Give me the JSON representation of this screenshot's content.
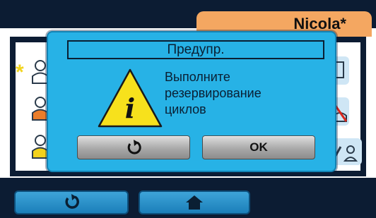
{
  "header": {
    "user_name": "Nicola*"
  },
  "background": {
    "rows": [
      {
        "user_icon": "user-person-white-icon",
        "starred": true,
        "star_glyph": "*",
        "side_icon": "user-scroll-icon"
      },
      {
        "user_icon": "user-person-orange-icon",
        "starred": false,
        "side_icon": "delete-user-icon"
      },
      {
        "user_icon": "user-person-yellow-icon",
        "starred": false,
        "side_icon": "edit-user-icon"
      }
    ],
    "bottom_buttons": [
      {
        "icon": "back-arrow-icon"
      },
      {
        "icon": "home-icon"
      }
    ]
  },
  "dialog": {
    "title": "Предупр.",
    "icon": "warning-info-icon",
    "icon_glyph": "i",
    "message_lines": [
      "Выполните",
      "резервирование",
      "циклов"
    ],
    "back_icon": "undo-arrow-icon",
    "ok_label": "OK"
  },
  "colors": {
    "dark_navy": "#0c1c33",
    "dialog_blue": "#27b2e6",
    "user_tab_orange": "#f4a761",
    "warning_yellow": "#f7e11c",
    "button_blue": "#2b93cc"
  }
}
